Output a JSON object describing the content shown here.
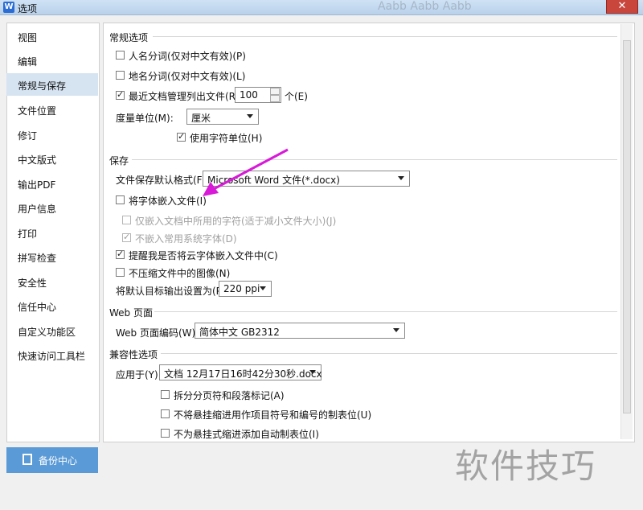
{
  "window": {
    "title": "选项",
    "app_icon_label": "W",
    "close_glyph": "✕"
  },
  "background_text": "Aabb Aabb Aabb",
  "nav": {
    "items": [
      "视图",
      "编辑",
      "常规与保存",
      "文件位置",
      "修订",
      "中文版式",
      "输出PDF",
      "用户信息",
      "打印",
      "拼写检查",
      "安全性",
      "信任中心",
      "自定义功能区",
      "快速访问工具栏"
    ],
    "selected": "常规与保存"
  },
  "sections": {
    "general": {
      "title": "常规选项",
      "person_name": "人名分词(仅对中文有效)(P)",
      "place_name": "地名分词(仅对中文有效)(L)",
      "recent_files_label": "最近文档管理列出文件(R):",
      "recent_files_value": "100",
      "recent_files_unit": "个(E)",
      "measure_label": "度量单位(M):",
      "measure_value": "厘米",
      "char_unit": "使用字符单位(H)"
    },
    "save": {
      "title": "保存",
      "format_label": "文件保存默认格式(F):",
      "format_value": "Microsoft Word 文件(*.docx)",
      "embed_fonts": "将字体嵌入文件(I)",
      "embed_used_only": "仅嵌入文档中所用的字符(适于减小文件大小)(J)",
      "no_common_fonts": "不嵌入常用系统字体(D)",
      "remind_cloud": "提醒我是否将云字体嵌入文件中(C)",
      "no_compress": "不压缩文件中的图像(N)",
      "ppi_label": "将默认目标输出设置为(P):",
      "ppi_value": "220 ppi"
    },
    "web": {
      "title": "Web 页面",
      "encoding_label": "Web 页面编码(W):",
      "encoding_value": "简体中文 GB2312"
    },
    "compat": {
      "title": "兼容性选项",
      "apply_label": "应用于(Y):",
      "apply_value": "文档 12月17日16时42分30秒.docx",
      "split_marks": "拆分分页符和段落标记(A)",
      "no_hanging_indent": "不将悬挂缩进用作项目符号和编号的制表位(U)",
      "no_auto_tab": "不为悬挂式缩进添加自动制表位(I)"
    }
  },
  "backup_button": "备份中心",
  "watermark": "软件技巧",
  "colors": {
    "selection": "#d6e3f1",
    "backup_button": "#5a9ad6",
    "annotation_arrow": "#d81ad8"
  }
}
